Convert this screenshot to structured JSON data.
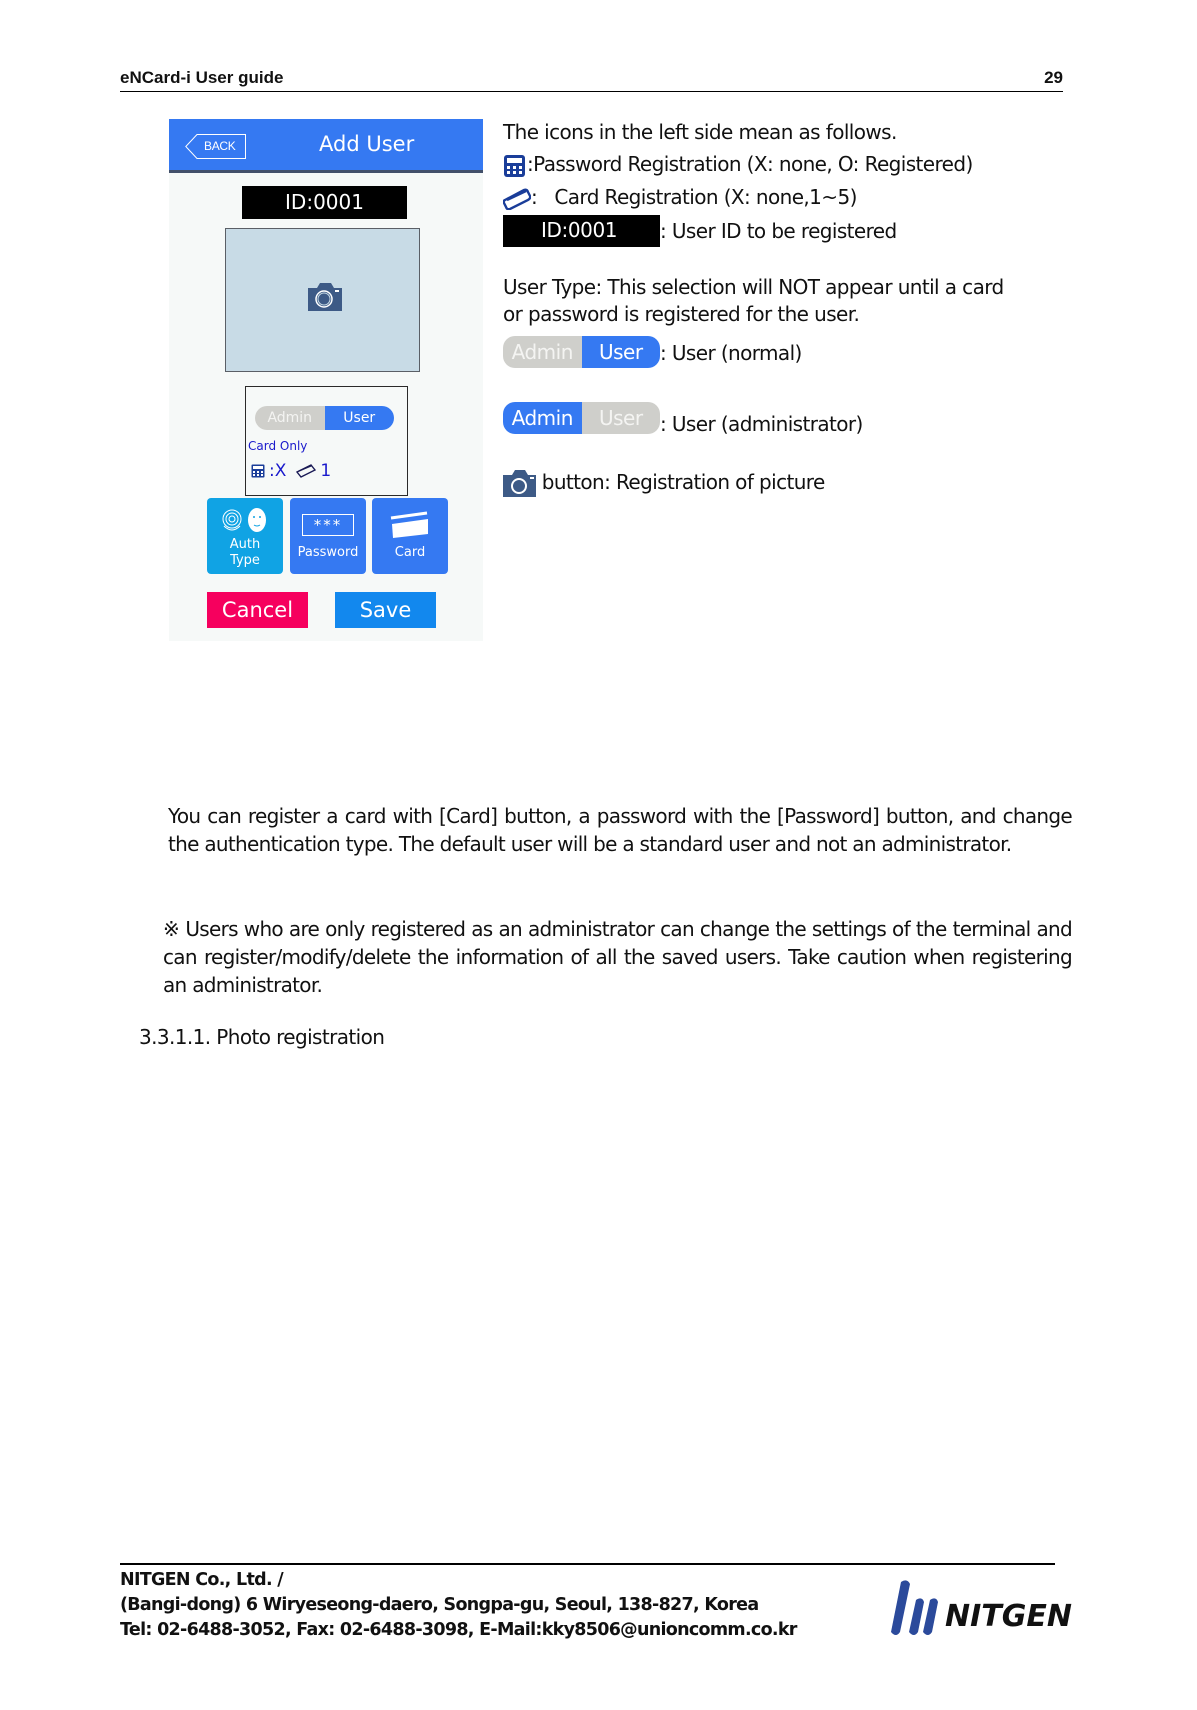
{
  "header": {
    "title": "eNCard-i User guide",
    "page_number": "29"
  },
  "device": {
    "back_label": "BACK",
    "screen_title": "Add User",
    "user_id": "ID:0001",
    "photo_icon": "camera-icon",
    "user_type_toggle": {
      "options": [
        "Admin",
        "User"
      ],
      "selected": "User"
    },
    "auth_type": "Card Only",
    "password_status": ":X",
    "card_count": "1",
    "buttons": {
      "auth_type": [
        "Auth",
        "Type"
      ],
      "password_glyph": "***",
      "password": "Password",
      "card": "Card",
      "cancel": "Cancel",
      "save": "Save"
    },
    "colors": {
      "title_bar": "#3579f2",
      "auth_button": "#10a3e4",
      "cancel": "#f6005e",
      "save": "#1288ee",
      "toggle_on": "#3579f2",
      "toggle_off": "#cfcfcb",
      "info_text": "#1a1acc"
    }
  },
  "explanations": {
    "intro": "The icons in the left side mean as follows.",
    "password_icon_desc": ":Password Registration (X: none, O: Registered)",
    "card_icon_desc": ":   Card Registration (X: none,1~5)",
    "id_sample": "ID:0001",
    "id_desc": ": User ID to be registered",
    "user_type_line1": "User Type: This selection will NOT appear until a card",
    "user_type_line2": "or password is registered for the user.",
    "toggle_normal": {
      "admin": "Admin",
      "user": "User",
      "desc": ": User (normal)"
    },
    "toggle_admin": {
      "admin": "Admin",
      "user": "User",
      "desc": ": User (administrator)"
    },
    "camera_desc": " button: Registration of picture"
  },
  "body": {
    "paragraph_1": "You can register a card with [Card] button, a password with the [Password] button, and change the authentication type. The default user will be a standard user and not an administrator.",
    "paragraph_2": "※ Users who are only registered as an administrator can change the settings of the terminal and can register/modify/delete the information of all the saved users. Take caution when registering an administrator.",
    "section_heading": "3.3.1.1. Photo registration"
  },
  "footer": {
    "company": "NITGEN Co., Ltd. /",
    "address": "(Bangi-dong) 6 Wiryeseong-daero, Songpa-gu, Seoul, 138-827, Korea",
    "contact": "Tel: 02-6488-3052, Fax: 02-6488-3098, E-Mail:kky8506@unioncomm.co.kr",
    "logo_text": "NITGEN",
    "logo_color": "#2b4a9b"
  }
}
